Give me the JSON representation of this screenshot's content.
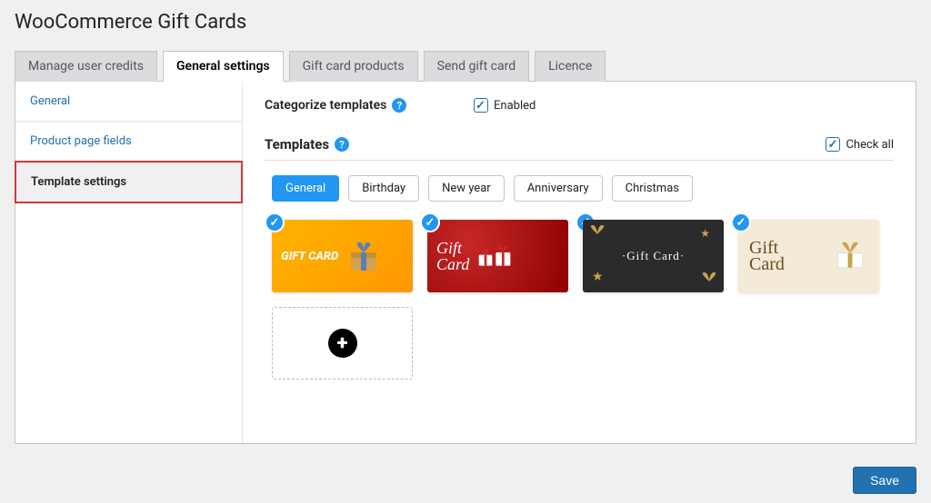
{
  "page_title": "WooCommerce Gift Cards",
  "tabs": {
    "manage": "Manage user credits",
    "general": "General settings",
    "products": "Gift card products",
    "send": "Send gift card",
    "licence": "Licence"
  },
  "sidebar": {
    "general": "General",
    "product_page": "Product page fields",
    "template_settings": "Template settings"
  },
  "categorize": {
    "label": "Categorize templates",
    "enabled_text": "Enabled"
  },
  "section": {
    "title": "Templates",
    "checkall": "Check all"
  },
  "categories": {
    "general": "General",
    "birthday": "Birthday",
    "newyear": "New year",
    "anniversary": "Anniversary",
    "christmas": "Christmas"
  },
  "cards": {
    "c1": "GIFT CARD",
    "c2": "Gift\nCard",
    "c3": "Gift Card",
    "c4": "Gift\nCard"
  },
  "save": "Save"
}
